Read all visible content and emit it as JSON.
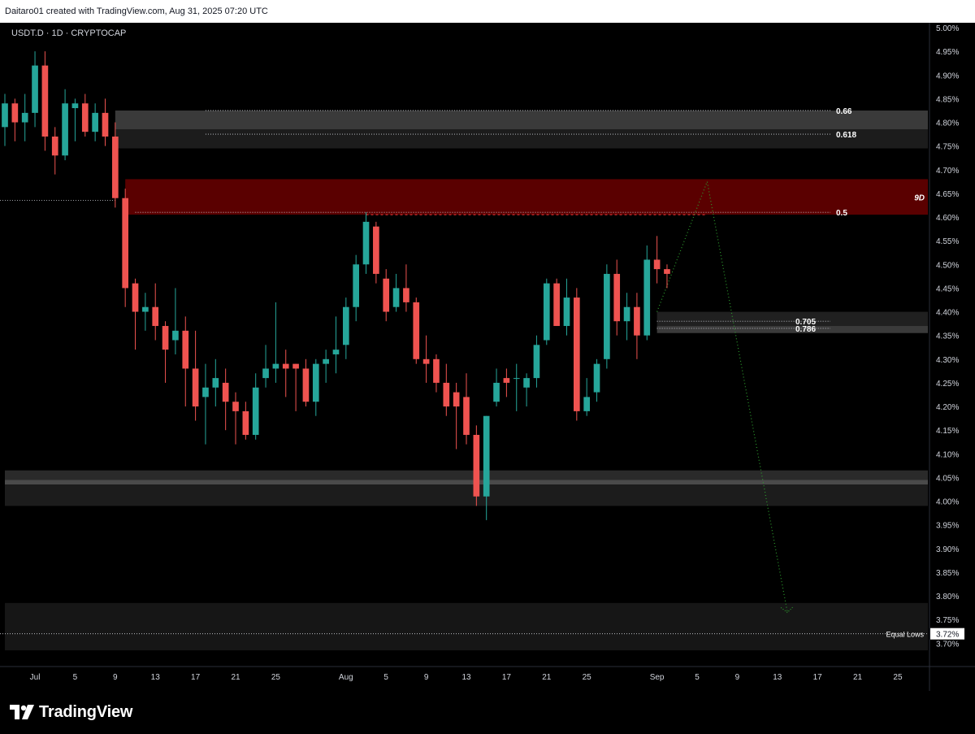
{
  "header": {
    "text": "Daitaro01 created with TradingView.com, Aug 31, 2025 07:20 UTC"
  },
  "footer": {
    "logo_text": "TradingView"
  },
  "chart_data": {
    "type": "candlestick",
    "symbol_label": "USDT.D · 1D · CRYPTOCAP",
    "y_ticks": [
      "5.00%",
      "4.95%",
      "4.90%",
      "4.85%",
      "4.80%",
      "4.75%",
      "4.70%",
      "4.65%",
      "4.60%",
      "4.55%",
      "4.50%",
      "4.45%",
      "4.40%",
      "4.35%",
      "4.30%",
      "4.25%",
      "4.20%",
      "4.15%",
      "4.10%",
      "4.05%",
      "4.00%",
      "3.95%",
      "3.90%",
      "3.85%",
      "3.80%",
      "3.75%",
      "3.70%"
    ],
    "ylim": [
      3.68,
      5.0
    ],
    "x_ticks": [
      {
        "label": "Jul",
        "date": "2025-07-01"
      },
      {
        "label": "5",
        "date": "2025-07-05"
      },
      {
        "label": "9",
        "date": "2025-07-09"
      },
      {
        "label": "13",
        "date": "2025-07-13"
      },
      {
        "label": "17",
        "date": "2025-07-17"
      },
      {
        "label": "21",
        "date": "2025-07-21"
      },
      {
        "label": "25",
        "date": "2025-07-25"
      },
      {
        "label": "Aug",
        "date": "2025-08-01"
      },
      {
        "label": "5",
        "date": "2025-08-05"
      },
      {
        "label": "9",
        "date": "2025-08-09"
      },
      {
        "label": "13",
        "date": "2025-08-13"
      },
      {
        "label": "17",
        "date": "2025-08-17"
      },
      {
        "label": "21",
        "date": "2025-08-21"
      },
      {
        "label": "25",
        "date": "2025-08-25"
      },
      {
        "label": "Sep",
        "date": "2025-09-01"
      },
      {
        "label": "5",
        "date": "2025-09-05"
      },
      {
        "label": "9",
        "date": "2025-09-09"
      },
      {
        "label": "13",
        "date": "2025-09-13"
      },
      {
        "label": "17",
        "date": "2025-09-17"
      },
      {
        "label": "21",
        "date": "2025-09-21"
      },
      {
        "label": "25",
        "date": "2025-09-25"
      }
    ],
    "xlim": [
      "2025-06-28",
      "2025-09-28"
    ],
    "colors": {
      "up": "#26a69a",
      "down": "#ef5350",
      "zone_red": "#5a0000",
      "zone_grey": "#2a2a2a",
      "projection": "#2e9e2e",
      "text": "#d1d4dc"
    },
    "candles": [
      {
        "date": "2025-06-28",
        "o": 4.79,
        "h": 4.86,
        "l": 4.75,
        "c": 4.84
      },
      {
        "date": "2025-06-29",
        "o": 4.84,
        "h": 4.85,
        "l": 4.76,
        "c": 4.8
      },
      {
        "date": "2025-06-30",
        "o": 4.8,
        "h": 4.86,
        "l": 4.76,
        "c": 4.82
      },
      {
        "date": "2025-07-01",
        "o": 4.82,
        "h": 4.95,
        "l": 4.79,
        "c": 4.92
      },
      {
        "date": "2025-07-02",
        "o": 4.92,
        "h": 4.95,
        "l": 4.74,
        "c": 4.77
      },
      {
        "date": "2025-07-03",
        "o": 4.77,
        "h": 4.79,
        "l": 4.69,
        "c": 4.73
      },
      {
        "date": "2025-07-04",
        "o": 4.73,
        "h": 4.87,
        "l": 4.72,
        "c": 4.84
      },
      {
        "date": "2025-07-05",
        "o": 4.83,
        "h": 4.85,
        "l": 4.76,
        "c": 4.84
      },
      {
        "date": "2025-07-06",
        "o": 4.84,
        "h": 4.86,
        "l": 4.77,
        "c": 4.78
      },
      {
        "date": "2025-07-07",
        "o": 4.78,
        "h": 4.84,
        "l": 4.76,
        "c": 4.82
      },
      {
        "date": "2025-07-08",
        "o": 4.82,
        "h": 4.85,
        "l": 4.75,
        "c": 4.77
      },
      {
        "date": "2025-07-09",
        "o": 4.77,
        "h": 4.8,
        "l": 4.62,
        "c": 4.64
      },
      {
        "date": "2025-07-10",
        "o": 4.64,
        "h": 4.66,
        "l": 4.41,
        "c": 4.45
      },
      {
        "date": "2025-07-11",
        "o": 4.46,
        "h": 4.47,
        "l": 4.32,
        "c": 4.4
      },
      {
        "date": "2025-07-12",
        "o": 4.4,
        "h": 4.44,
        "l": 4.36,
        "c": 4.41
      },
      {
        "date": "2025-07-13",
        "o": 4.41,
        "h": 4.46,
        "l": 4.34,
        "c": 4.37
      },
      {
        "date": "2025-07-14",
        "o": 4.37,
        "h": 4.38,
        "l": 4.25,
        "c": 4.32
      },
      {
        "date": "2025-07-15",
        "o": 4.34,
        "h": 4.45,
        "l": 4.31,
        "c": 4.36
      },
      {
        "date": "2025-07-16",
        "o": 4.36,
        "h": 4.39,
        "l": 4.2,
        "c": 4.28
      },
      {
        "date": "2025-07-17",
        "o": 4.28,
        "h": 4.36,
        "l": 4.17,
        "c": 4.2
      },
      {
        "date": "2025-07-18",
        "o": 4.22,
        "h": 4.29,
        "l": 4.12,
        "c": 4.24
      },
      {
        "date": "2025-07-19",
        "o": 4.24,
        "h": 4.3,
        "l": 4.2,
        "c": 4.26
      },
      {
        "date": "2025-07-20",
        "o": 4.25,
        "h": 4.28,
        "l": 4.15,
        "c": 4.21
      },
      {
        "date": "2025-07-21",
        "o": 4.21,
        "h": 4.23,
        "l": 4.12,
        "c": 4.19
      },
      {
        "date": "2025-07-22",
        "o": 4.19,
        "h": 4.21,
        "l": 4.13,
        "c": 4.14
      },
      {
        "date": "2025-07-23",
        "o": 4.14,
        "h": 4.27,
        "l": 4.13,
        "c": 4.24
      },
      {
        "date": "2025-07-24",
        "o": 4.26,
        "h": 4.33,
        "l": 4.24,
        "c": 4.28
      },
      {
        "date": "2025-07-25",
        "o": 4.28,
        "h": 4.42,
        "l": 4.25,
        "c": 4.29
      },
      {
        "date": "2025-07-26",
        "o": 4.29,
        "h": 4.32,
        "l": 4.22,
        "c": 4.28
      },
      {
        "date": "2025-07-27",
        "o": 4.29,
        "h": 4.29,
        "l": 4.19,
        "c": 4.28
      },
      {
        "date": "2025-07-28",
        "o": 4.28,
        "h": 4.3,
        "l": 4.2,
        "c": 4.21
      },
      {
        "date": "2025-07-29",
        "o": 4.21,
        "h": 4.3,
        "l": 4.18,
        "c": 4.29
      },
      {
        "date": "2025-07-30",
        "o": 4.29,
        "h": 4.32,
        "l": 4.25,
        "c": 4.3
      },
      {
        "date": "2025-07-31",
        "o": 4.31,
        "h": 4.39,
        "l": 4.27,
        "c": 4.32
      },
      {
        "date": "2025-08-01",
        "o": 4.33,
        "h": 4.43,
        "l": 4.3,
        "c": 4.41
      },
      {
        "date": "2025-08-02",
        "o": 4.41,
        "h": 4.52,
        "l": 4.38,
        "c": 4.5
      },
      {
        "date": "2025-08-03",
        "o": 4.5,
        "h": 4.61,
        "l": 4.48,
        "c": 4.59
      },
      {
        "date": "2025-08-04",
        "o": 4.58,
        "h": 4.59,
        "l": 4.46,
        "c": 4.48
      },
      {
        "date": "2025-08-05",
        "o": 4.47,
        "h": 4.49,
        "l": 4.38,
        "c": 4.4
      },
      {
        "date": "2025-08-06",
        "o": 4.41,
        "h": 4.48,
        "l": 4.4,
        "c": 4.45
      },
      {
        "date": "2025-08-07",
        "o": 4.45,
        "h": 4.5,
        "l": 4.4,
        "c": 4.42
      },
      {
        "date": "2025-08-08",
        "o": 4.42,
        "h": 4.43,
        "l": 4.29,
        "c": 4.3
      },
      {
        "date": "2025-08-09",
        "o": 4.3,
        "h": 4.35,
        "l": 4.25,
        "c": 4.29
      },
      {
        "date": "2025-08-10",
        "o": 4.3,
        "h": 4.31,
        "l": 4.23,
        "c": 4.25
      },
      {
        "date": "2025-08-11",
        "o": 4.25,
        "h": 4.29,
        "l": 4.18,
        "c": 4.2
      },
      {
        "date": "2025-08-12",
        "o": 4.23,
        "h": 4.25,
        "l": 4.11,
        "c": 4.2
      },
      {
        "date": "2025-08-13",
        "o": 4.22,
        "h": 4.27,
        "l": 4.12,
        "c": 4.14
      },
      {
        "date": "2025-08-14",
        "o": 4.14,
        "h": 4.16,
        "l": 3.99,
        "c": 4.01
      },
      {
        "date": "2025-08-15",
        "o": 4.01,
        "h": 4.18,
        "l": 3.96,
        "c": 4.18
      },
      {
        "date": "2025-08-16",
        "o": 4.21,
        "h": 4.28,
        "l": 4.2,
        "c": 4.25
      },
      {
        "date": "2025-08-17",
        "o": 4.26,
        "h": 4.28,
        "l": 4.22,
        "c": 4.25
      },
      {
        "date": "2025-08-18",
        "o": 4.26,
        "h": 4.29,
        "l": 4.19,
        "c": 4.26
      },
      {
        "date": "2025-08-19",
        "o": 4.24,
        "h": 4.27,
        "l": 4.2,
        "c": 4.26
      },
      {
        "date": "2025-08-20",
        "o": 4.26,
        "h": 4.35,
        "l": 4.24,
        "c": 4.33
      },
      {
        "date": "2025-08-21",
        "o": 4.34,
        "h": 4.47,
        "l": 4.33,
        "c": 4.46
      },
      {
        "date": "2025-08-22",
        "o": 4.46,
        "h": 4.47,
        "l": 4.37,
        "c": 4.37
      },
      {
        "date": "2025-08-23",
        "o": 4.37,
        "h": 4.47,
        "l": 4.35,
        "c": 4.43
      },
      {
        "date": "2025-08-24",
        "o": 4.43,
        "h": 4.45,
        "l": 4.17,
        "c": 4.19
      },
      {
        "date": "2025-08-25",
        "o": 4.19,
        "h": 4.26,
        "l": 4.18,
        "c": 4.22
      },
      {
        "date": "2025-08-26",
        "o": 4.23,
        "h": 4.3,
        "l": 4.21,
        "c": 4.29
      },
      {
        "date": "2025-08-27",
        "o": 4.3,
        "h": 4.5,
        "l": 4.28,
        "c": 4.48
      },
      {
        "date": "2025-08-28",
        "o": 4.48,
        "h": 4.51,
        "l": 4.35,
        "c": 4.38
      },
      {
        "date": "2025-08-29",
        "o": 4.38,
        "h": 4.44,
        "l": 4.34,
        "c": 4.41
      },
      {
        "date": "2025-08-30",
        "o": 4.41,
        "h": 4.44,
        "l": 4.3,
        "c": 4.35
      },
      {
        "date": "2025-08-31",
        "o": 4.35,
        "h": 4.54,
        "l": 4.34,
        "c": 4.51
      },
      {
        "date": "2025-09-01",
        "o": 4.51,
        "h": 4.56,
        "l": 4.46,
        "c": 4.49
      },
      {
        "date": "2025-09-02",
        "o": 4.49,
        "h": 4.5,
        "l": 4.45,
        "c": 4.48
      }
    ],
    "zones": [
      {
        "name": "upper-resistance",
        "from": "2025-07-09",
        "to": "2025-09-28",
        "y1": 4.785,
        "y2": 4.825,
        "color": "#3a3a3a"
      },
      {
        "name": "upper-resistance-lower",
        "from": "2025-07-09",
        "to": "2025-09-28",
        "y1": 4.745,
        "y2": 4.785,
        "color": "#1c1c1c"
      },
      {
        "name": "supply-zone",
        "from": "2025-07-10",
        "to": "2025-09-28",
        "y1": 4.605,
        "y2": 4.68,
        "color": "#5a0000",
        "label": "9D"
      },
      {
        "name": "entry-zone",
        "from": "2025-09-01",
        "to": "2025-09-28",
        "y1": 4.36,
        "y2": 4.4,
        "color": "#202020"
      },
      {
        "name": "entry-zone-lower",
        "from": "2025-09-01",
        "to": "2025-09-28",
        "y1": 4.355,
        "y2": 4.37,
        "color": "#3a3a3a"
      },
      {
        "name": "support-zone",
        "from": "2025-06-28",
        "to": "2025-09-28",
        "y1": 4.045,
        "y2": 4.065,
        "color": "#2a2a2a"
      },
      {
        "name": "support-zone-mid",
        "from": "2025-06-28",
        "to": "2025-09-28",
        "y1": 4.035,
        "y2": 4.045,
        "color": "#4a4a4a"
      },
      {
        "name": "support-zone-lower",
        "from": "2025-06-28",
        "to": "2025-09-28",
        "y1": 3.99,
        "y2": 4.035,
        "color": "#1c1c1c"
      },
      {
        "name": "bottom-zone",
        "from": "2025-06-28",
        "to": "2025-09-28",
        "y1": 3.685,
        "y2": 3.785,
        "color": "#161616"
      }
    ],
    "fib_levels": [
      {
        "label": "0.66",
        "value": 4.825,
        "from": "2025-07-18"
      },
      {
        "label": "0.618",
        "value": 4.775,
        "from": "2025-07-18"
      },
      {
        "label": "0.5",
        "value": 4.61,
        "from": "2025-07-11"
      },
      {
        "label": "0.705",
        "value": 4.38,
        "from": "2025-09-01"
      },
      {
        "label": "0.786",
        "value": 4.365,
        "from": "2025-09-01"
      }
    ],
    "equal_lows": {
      "label": "Equal Lows",
      "value": 3.72,
      "badge": "3.72%"
    },
    "left_line": {
      "value": 4.635,
      "to": "2025-07-09"
    },
    "red_dashed": {
      "value": 4.605,
      "from": "2025-08-03",
      "to": "2025-09-06"
    },
    "projection": [
      {
        "date": "2025-09-01",
        "value": 4.4
      },
      {
        "date": "2025-09-06",
        "value": 4.675
      },
      {
        "date": "2025-09-14",
        "value": 3.765
      }
    ]
  }
}
